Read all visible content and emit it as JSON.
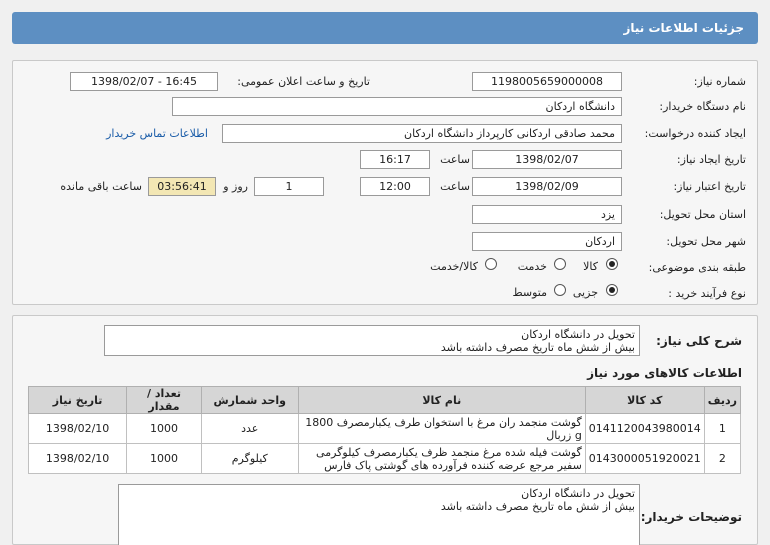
{
  "header": {
    "title": "جزئیات اطلاعات نیاز"
  },
  "form": {
    "need_number_label": "شماره نیاز:",
    "need_number": "1198005659000008",
    "announce_label": "تاریخ و ساعت اعلان عمومی:",
    "announce_value": "1398/02/07 - 16:45",
    "buyer_label": "نام دستگاه خریدار:",
    "buyer_value": "دانشگاه اردکان",
    "creator_label": "ایجاد کننده درخواست:",
    "creator_value": "محمد صادقی اردکانی کارپرداز دانشگاه اردکان",
    "contact_link": "اطلاعات تماس خریدار",
    "create_date_label": "تاریخ ایجاد نیاز:",
    "create_date": "1398/02/07",
    "time_label": "ساعت",
    "create_time": "16:17",
    "validity_label": "تاریخ اعتبار نیاز:",
    "validity_date": "1398/02/09",
    "validity_time": "12:00",
    "days_value": "1",
    "days_label": "روز و",
    "remaining_time": "03:56:41",
    "remaining_label": "ساعت باقی مانده",
    "province_label": "استان محل تحویل:",
    "province_value": "یزد",
    "city_label": "شهر محل تحویل:",
    "city_value": "اردکان",
    "category_label": "طبقه بندی موضوعی:",
    "category_options": [
      "کالا",
      "خدمت",
      "کالا/خدمت"
    ],
    "process_label": "نوع فرآیند خرید :",
    "process_options": [
      "جزیی",
      "متوسط"
    ]
  },
  "summary": {
    "label": "شرح کلی نیاز:",
    "line1": "تحویل در دانشگاه اردکان",
    "line2": "بیش از شش ماه تاریخ مصرف داشته باشد"
  },
  "items": {
    "section_title": "اطلاعات کالاهای مورد نیاز",
    "columns": [
      "ردیف",
      "کد کالا",
      "نام کالا",
      "واحد شمارش",
      "تعداد / مقدار",
      "تاریخ نیاز"
    ],
    "rows": [
      {
        "row": "1",
        "code": "0141120043980014",
        "name": "گوشت منجمد ران مرغ با استخوان طرف یکبارمصرف 1800 g زربال",
        "unit": "عدد",
        "qty": "1000",
        "date": "1398/02/10"
      },
      {
        "row": "2",
        "code": "0143000051920021",
        "name": "گوشت فیله شده مرغ منجمد ظرف یکبارمصرف کیلوگرمی سفیر مرجع عرضه کننده فرآورده های گوشتی پاک فارس",
        "unit": "کیلوگرم",
        "qty": "1000",
        "date": "1398/02/10"
      }
    ]
  },
  "buyer_notes": {
    "label": "توضیحات خریدار:",
    "line1": "تحویل در دانشگاه اردکان",
    "line2": "بیش از شش ماه تاریخ مصرف داشته باشد"
  }
}
